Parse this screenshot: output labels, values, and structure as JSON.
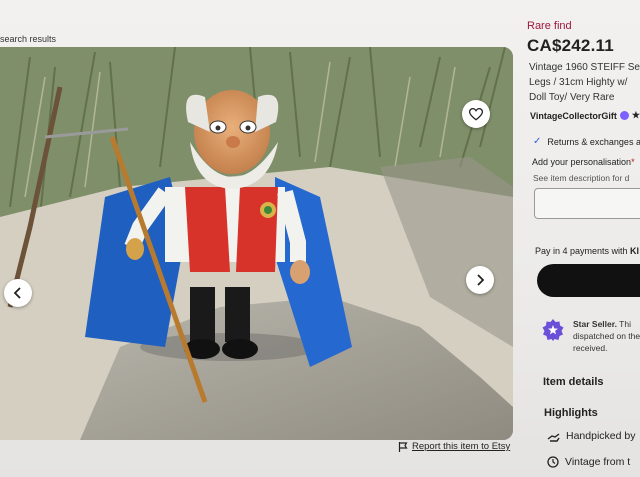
{
  "breadcrumb": "search results",
  "listing": {
    "rare_label": "Rare find",
    "price": "CA$242.11",
    "title": "Vintage 1960 STEIFF Se... Legs / 31cm Highty w/... Doll Toy/ Very Rare",
    "title_lines": [
      "Vintage 1960 STEIFF Se",
      "Legs / 31cm Highty w/",
      "Doll Toy/ Very Rare"
    ],
    "seller": "VintageCollectorGift",
    "seller_rating_star": "★",
    "returns": "Returns & exchanges a",
    "personalisation_label": "Add your personalisation",
    "personalisation_required": "*",
    "personalisation_desc": "See item description for d",
    "pay_prefix": "Pay in 4 payments with ",
    "pay_provider": "Kl",
    "star_seller_title": "Star Seller.",
    "star_seller_text": " Thi dispatched on they received.",
    "item_details": "Item details",
    "highlights": "Highlights",
    "highlight_1": "Handpicked by",
    "highlight_2": "Vintage from t"
  },
  "report_link": "Report this item to Etsy",
  "icons": {
    "favorite": "heart-icon",
    "prev": "chevron-left-icon",
    "next": "chevron-right-icon",
    "report": "flag-icon",
    "returns": "checkmark-icon",
    "star_seller": "star-seller-badge-icon",
    "handpicked": "hand-icon",
    "vintage": "clock-icon"
  },
  "colors": {
    "rare": "#a2153b",
    "button": "#111111",
    "badge": "#7b61ff"
  }
}
